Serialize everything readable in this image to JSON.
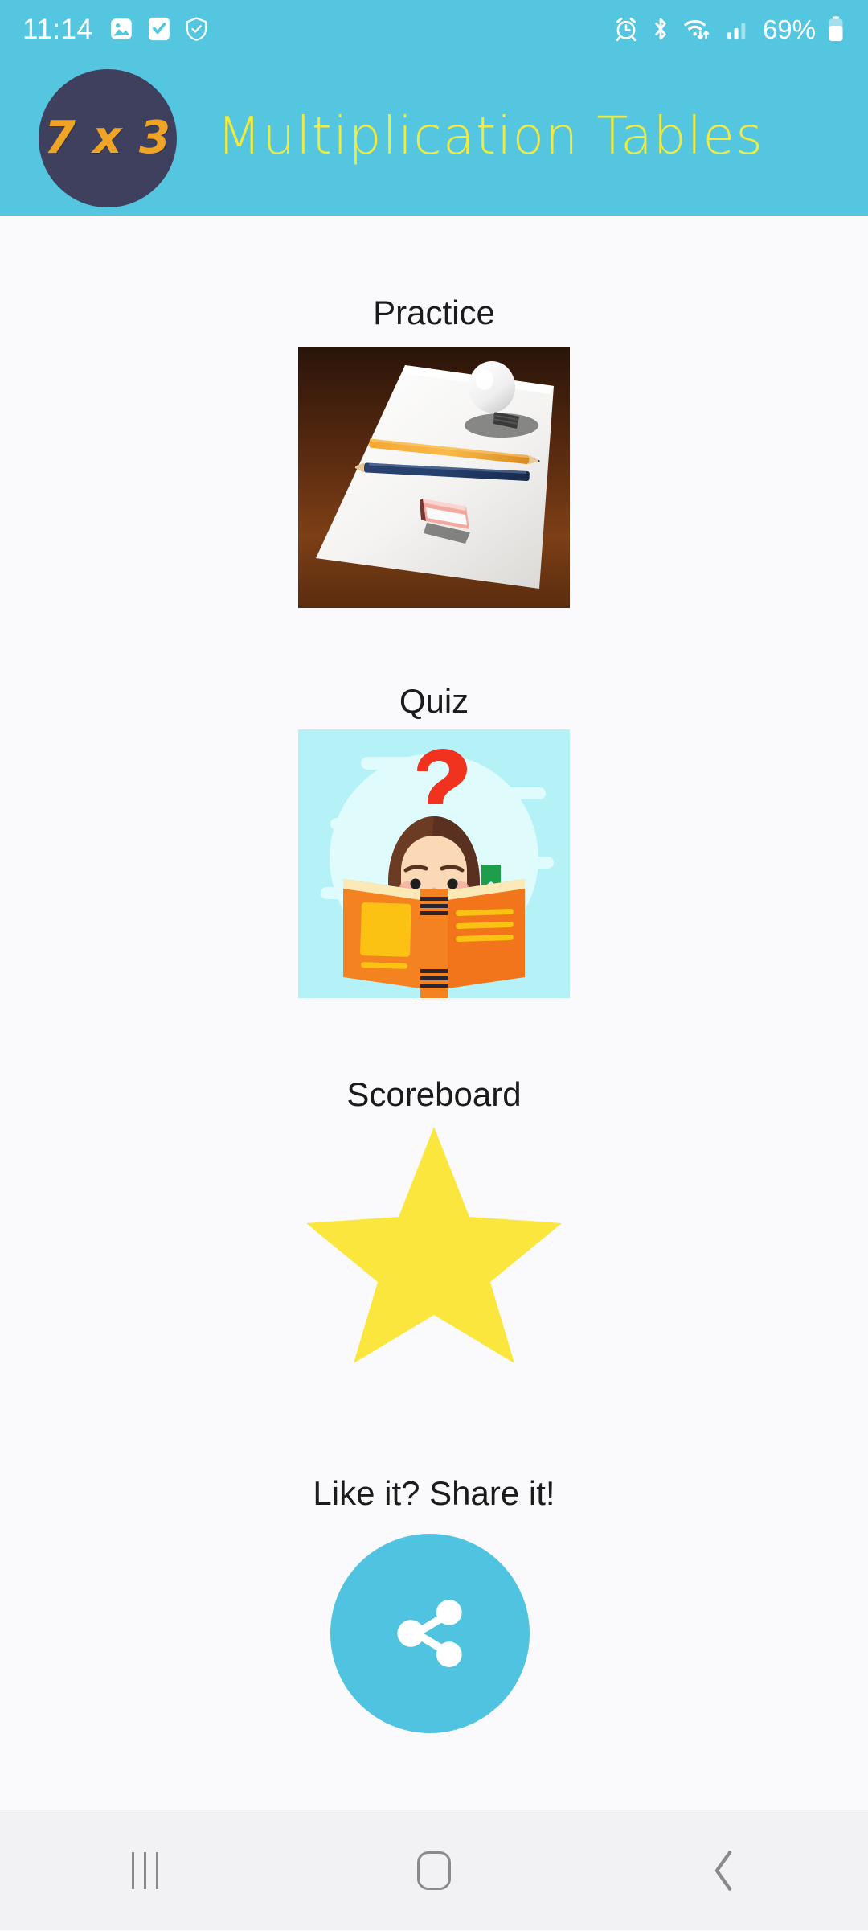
{
  "status_bar": {
    "time": "11:14",
    "battery_percent": "69%",
    "left_icons": [
      "gallery-icon",
      "tasks-icon",
      "shield-icon"
    ],
    "right_icons": [
      "alarm-icon",
      "bluetooth-icon",
      "wifi-icon",
      "signal-icon",
      "battery-icon"
    ],
    "background_color": "#55C6E0",
    "foreground_color": "#FFFFFF"
  },
  "header": {
    "logo_text": "7 x 3",
    "logo_background": "#3F3F5E",
    "logo_text_color": "#EFA425",
    "title": "Multiplication Tables",
    "title_color": "#F2EA3C",
    "background_color": "#55C6E0"
  },
  "main": {
    "background_color": "#FAFAFC",
    "sections": [
      {
        "key": "practice",
        "label": "Practice",
        "image_name": "practice-image-desk-with-pencils-and-lightbulb",
        "description": "White sheet of paper on a dark wooden desk with a lightbulb, an orange pencil, a blue pencil and an eraser"
      },
      {
        "key": "quiz",
        "label": "Quiz",
        "image_name": "quiz-image-child-reading-book-with-question-mark",
        "description": "Cartoon child with brown hair reading an orange book, red question mark above, light cyan background"
      },
      {
        "key": "scoreboard",
        "label": "Scoreboard",
        "image_name": "scoreboard-star-icon",
        "description": "Bright yellow five-pointed star",
        "star_color": "#FAE63C"
      },
      {
        "key": "share",
        "label": "Like it? Share it!",
        "image_name": "share-icon",
        "description": "Cyan circular button with a white share glyph",
        "button_color": "#4FC3DF",
        "icon_color": "#FFFFFF"
      }
    ]
  },
  "nav_bar": {
    "background_color": "#F2F2F4",
    "icon_color": "#8A8A8E",
    "buttons": [
      {
        "name": "recents-button",
        "icon": "recents-icon"
      },
      {
        "name": "home-button",
        "icon": "home-icon"
      },
      {
        "name": "back-button",
        "icon": "back-chevron-icon"
      }
    ]
  }
}
